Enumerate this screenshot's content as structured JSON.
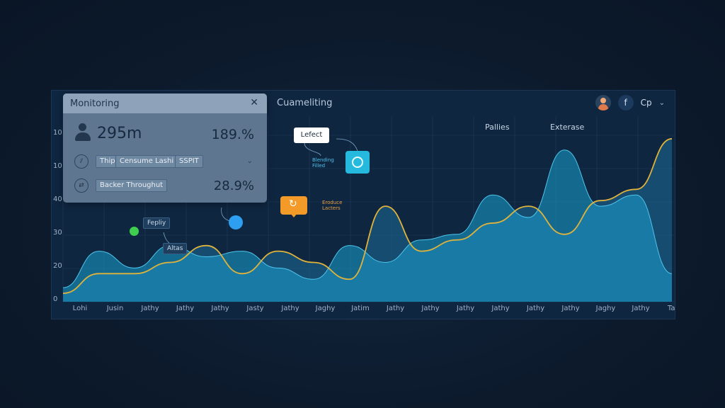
{
  "header": {
    "title": "Cuameliting",
    "columns": [
      "Pallies",
      "Exterase"
    ],
    "user": "Cp"
  },
  "card": {
    "title": "Monitoring",
    "primary_value": "295m",
    "primary_pct": "189.%",
    "row1_chips": [
      "Thip",
      "Censume Lashi",
      "SSPIT"
    ],
    "row2_chip": "Backer Throughut",
    "secondary_pct": "28.9%"
  },
  "annotations": {
    "callout_label": "Lefect",
    "blue_note": "Blending\nFilled",
    "orange_note": "Eroduce\nLacters",
    "tag1": "Fepliy",
    "tag2": "Altas"
  },
  "chart_data": {
    "type": "area",
    "y_ticks": [
      "0",
      "20",
      "30",
      "40",
      "10",
      "10"
    ],
    "x": [
      "Lohi",
      "Jusin",
      "Jathy",
      "Jathy",
      "Jathy",
      "Jasty",
      "Jathy",
      "Jaghy",
      "Jatim",
      "Jathy",
      "Jathy",
      "Jathy",
      "Jathy",
      "Jathy",
      "Jathy",
      "Jaghy",
      "Jathy",
      "Tagh"
    ],
    "series": [
      {
        "values": [
          5,
          18,
          12,
          20,
          16,
          18,
          12,
          8,
          20,
          14,
          22,
          24,
          38,
          30,
          54,
          34,
          38,
          10
        ]
      },
      {
        "values": [
          3,
          10,
          10,
          14,
          20,
          10,
          18,
          14,
          8,
          34,
          18,
          22,
          28,
          34,
          24,
          36,
          40,
          58
        ]
      }
    ],
    "ylim": [
      0,
      60
    ],
    "colors": {
      "area_back": "#1b5a82",
      "area_front": "#1aa0cf",
      "line": "#e0b43c",
      "grid": "#1f3b5a"
    }
  },
  "markers": {
    "green": "#3fcf4f",
    "blue": "#2d9ef0"
  }
}
